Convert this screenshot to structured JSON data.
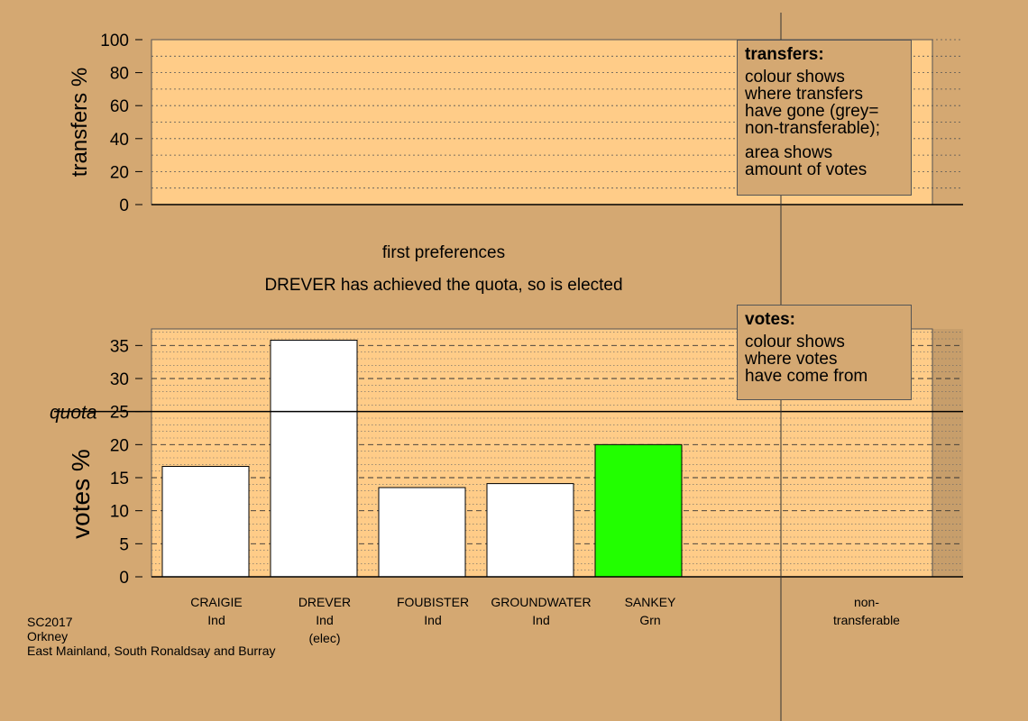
{
  "transfers_legend": {
    "title": "transfers:",
    "lines1": [
      "colour shows",
      "where transfers",
      "have gone (grey=",
      "non-transferable);"
    ],
    "lines2": [
      "area shows",
      "amount of votes"
    ]
  },
  "votes_legend": {
    "title": "votes:",
    "lines": [
      "colour shows",
      "where votes",
      "have come from"
    ]
  },
  "captions": {
    "stage": "first preferences",
    "status": "DREVER has achieved the quota, so is elected"
  },
  "footer": {
    "line1": "SC2017",
    "line2": "Orkney",
    "line3": "East Mainland, South Ronaldsay and Burray"
  },
  "colors": {
    "background": "#d4a872",
    "plot_fill": "#ffcc88",
    "bar_default": "#ffffff",
    "bar_grn": "#22ff00",
    "axis": "#000000"
  },
  "chart_data": [
    {
      "type": "bar",
      "name": "transfers",
      "ylabel": "transfers %",
      "ylim": [
        0,
        100
      ],
      "yticks": [
        0,
        20,
        40,
        60,
        80,
        100
      ],
      "categories": [],
      "values": []
    },
    {
      "type": "bar",
      "name": "votes",
      "ylabel": "votes %",
      "ylim": [
        0,
        37.5
      ],
      "yticks": [
        0,
        5,
        10,
        15,
        20,
        25,
        30,
        35
      ],
      "quota": 25,
      "quota_label": "quota",
      "categories": [
        {
          "name": "CRAIGIE",
          "party": "Ind",
          "note": "",
          "value": 16.7,
          "color": "#ffffff"
        },
        {
          "name": "DREVER",
          "party": "Ind",
          "note": "(elec)",
          "value": 35.8,
          "color": "#ffffff"
        },
        {
          "name": "FOUBISTER",
          "party": "Ind",
          "note": "",
          "value": 13.5,
          "color": "#ffffff"
        },
        {
          "name": "GROUNDWATER",
          "party": "Ind",
          "note": "",
          "value": 14.1,
          "color": "#ffffff"
        },
        {
          "name": "SANKEY",
          "party": "Grn",
          "note": "",
          "value": 20.0,
          "color": "#22ff00"
        }
      ],
      "nontransferable_label": [
        "non-",
        "transferable"
      ],
      "nontransferable_value": 0
    }
  ]
}
